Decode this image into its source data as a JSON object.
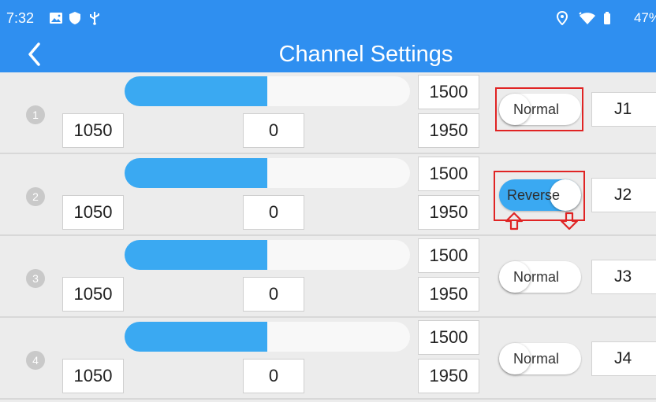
{
  "status_bar": {
    "time": "7:32",
    "battery": "47%",
    "icons": [
      "gallery-icon",
      "shield-icon",
      "usb-icon",
      "location-icon",
      "wifi-icon",
      "battery-icon"
    ]
  },
  "app_bar": {
    "title": "Channel Settings",
    "back_icon": "chevron-left-icon"
  },
  "channels": [
    {
      "index": "1",
      "min": "1050",
      "center": "0",
      "mid": "1500",
      "max": "1950",
      "slider_level": 0.5,
      "direction": "Normal",
      "mapping": "J1"
    },
    {
      "index": "2",
      "min": "1050",
      "center": "0",
      "mid": "1500",
      "max": "1950",
      "slider_level": 0.5,
      "direction": "Reverse",
      "mapping": "J2"
    },
    {
      "index": "3",
      "min": "1050",
      "center": "0",
      "mid": "1500",
      "max": "1950",
      "slider_level": 0.5,
      "direction": "Normal",
      "mapping": "J3"
    },
    {
      "index": "4",
      "min": "1050",
      "center": "0",
      "mid": "1500",
      "max": "1950",
      "slider_level": 0.5,
      "direction": "Normal",
      "mapping": "J4"
    }
  ],
  "annotation": {
    "highlight_color": "#e02424",
    "arrow_icons": [
      "arrow-up-icon",
      "arrow-down-icon"
    ]
  },
  "colors": {
    "accent": "#2f8ff0",
    "slider_fill": "#3aa9f2",
    "background": "#ececec"
  }
}
